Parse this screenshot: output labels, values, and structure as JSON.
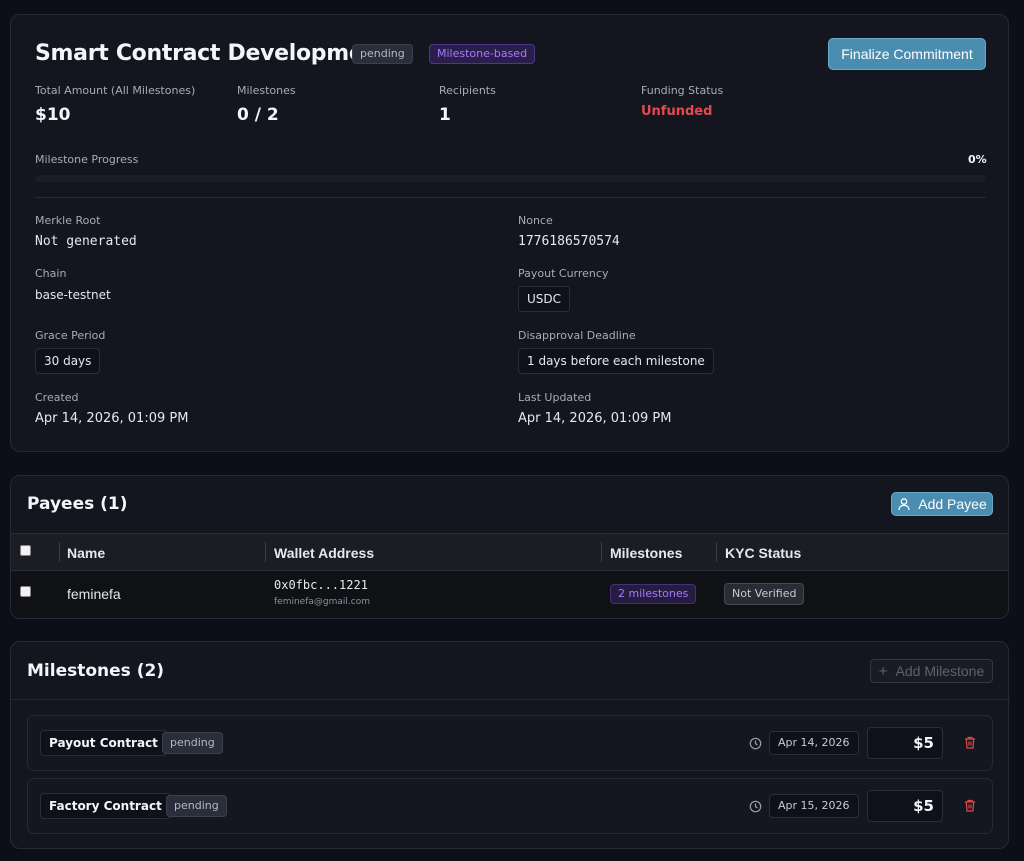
{
  "commitment": {
    "title": "Smart Contract Development",
    "status_badge": "pending",
    "type_badge": "Milestone-based",
    "finalize_label": "Finalize Commitment",
    "stats": {
      "total_label": "Total Amount (All Milestones)",
      "total_value": "$10",
      "milestones_label": "Milestones",
      "milestones_value": "0 / 2",
      "recipients_label": "Recipients",
      "recipients_value": "1",
      "funding_label": "Funding Status",
      "funding_value": "Unfunded"
    },
    "progress": {
      "label": "Milestone Progress",
      "value_text": "0%",
      "fraction": 0
    },
    "details": {
      "merkle_label": "Merkle Root",
      "merkle_value": "Not generated",
      "nonce_label": "Nonce",
      "nonce_value": "1776186570574",
      "chain_label": "Chain",
      "chain_value": "base-testnet",
      "currency_label": "Payout Currency",
      "currency_value": "USDC",
      "grace_label": "Grace Period",
      "grace_value": "30 days",
      "disapproval_label": "Disapproval Deadline",
      "disapproval_value": "1 days before each milestone",
      "created_label": "Created",
      "created_value": "Apr 14, 2026, 01:09 PM",
      "updated_label": "Last Updated",
      "updated_value": "Apr 14, 2026, 01:09 PM"
    }
  },
  "payees": {
    "title": "Payees (1)",
    "add_label": "Add Payee",
    "columns": [
      "Name",
      "Wallet Address",
      "Milestones",
      "KYC Status"
    ],
    "rows": [
      {
        "name": "feminefa",
        "wallet": "0x0fbc...1221",
        "email": "feminefa@gmail.com",
        "milestones": "2 milestones",
        "kyc": "Not Verified"
      }
    ]
  },
  "milestones": {
    "title": "Milestones (2)",
    "add_label": "Add Milestone",
    "items": [
      {
        "name": "Payout Contract",
        "status": "pending",
        "date": "Apr 14, 2026",
        "amount": "$5"
      },
      {
        "name": "Factory Contract",
        "status": "pending",
        "date": "Apr 15, 2026",
        "amount": "$5"
      }
    ]
  },
  "colors": {
    "accent": "#4b8db0",
    "danger": "#e5484d",
    "purple": "#a779ff"
  }
}
